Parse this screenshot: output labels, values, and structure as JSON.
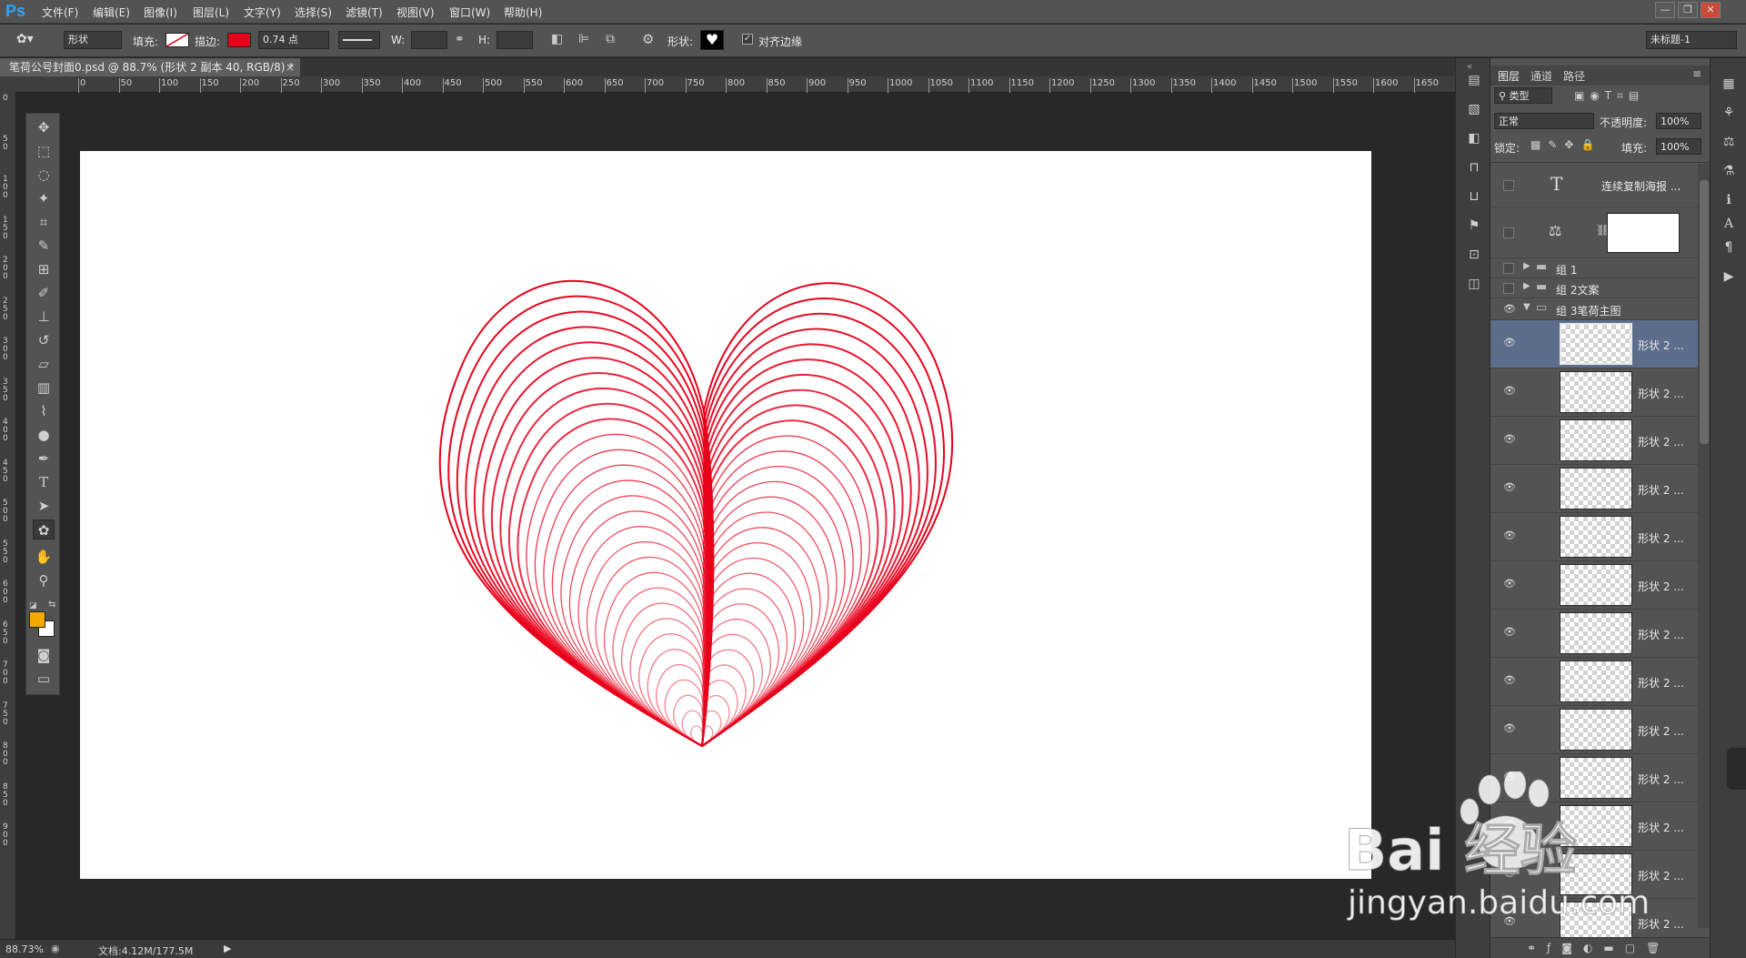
{
  "app": {
    "logo": "Ps"
  },
  "menu": [
    "文件(F)",
    "编辑(E)",
    "图像(I)",
    "图层(L)",
    "文字(Y)",
    "选择(S)",
    "滤镜(T)",
    "视图(V)",
    "窗口(W)",
    "帮助(H)"
  ],
  "window_buttons": [
    "—",
    "❐",
    "✕"
  ],
  "options": {
    "mode": "形状",
    "fill_label": "填充:",
    "stroke_label": "描边:",
    "stroke_color": "#e8001a",
    "stroke_width": "0.74 点",
    "w_label": "W:",
    "h_label": "H:",
    "shape_label": "形状:",
    "align_edges": "对齐边缘",
    "workspace": "未标题-1"
  },
  "document": {
    "tab_title": "笔荷公号封面0.psd @ 88.7% (形状 2 副本 40, RGB/8) *"
  },
  "ruler": {
    "h_ticks": [
      "0",
      "50",
      "100",
      "150",
      "200",
      "250",
      "300",
      "350",
      "400",
      "450",
      "500",
      "550",
      "600",
      "650",
      "700",
      "750",
      "800",
      "850",
      "900",
      "950",
      "1000",
      "1050",
      "1100",
      "1150",
      "1200",
      "1250",
      "1300",
      "1350",
      "1400",
      "1450",
      "1500",
      "1550",
      "1600",
      "1650"
    ],
    "v_ticks": [
      "0",
      "5 0",
      "1 0 0",
      "1 5 0",
      "2 0 0",
      "2 5 0",
      "3 0 0",
      "3 5 0",
      "4 0 0",
      "4 5 0",
      "5 0 0",
      "5 5 0",
      "6 0 0",
      "6 5 0",
      "7 0 0",
      "7 5 0",
      "8 0 0",
      "8 5 0",
      "9 0 0"
    ]
  },
  "tools": [
    "move-icon",
    "marquee-icon",
    "lasso-icon",
    "magic-wand-icon",
    "crop-icon",
    "eyedropper-icon",
    "healing-icon",
    "brush-icon",
    "stamp-icon",
    "history-brush-icon",
    "eraser-icon",
    "gradient-icon",
    "blur-icon",
    "dodge-icon",
    "pen-icon",
    "type-icon",
    "path-select-icon",
    "shape-icon",
    "hand-icon",
    "zoom-icon"
  ],
  "colors": {
    "foreground": "#f5a800",
    "background": "#ffffff",
    "heart_stroke": "#e8001a"
  },
  "status": {
    "zoom": "88.73%",
    "doc_size": "文档:4.12M/177.5M"
  },
  "layers_panel": {
    "tabs": [
      "图层",
      "通道",
      "路径"
    ],
    "filter_label": "类型",
    "blend_mode": "正常",
    "opacity_label": "不透明度:",
    "opacity_value": "100%",
    "lock_label": "锁定:",
    "fill_label": "填充:",
    "fill_value": "100%",
    "text_layer_name": "连续复制海报 ...",
    "groups": [
      "组 1",
      "组 2文案",
      "组 3笔荷主图"
    ],
    "shape_layer_name": "形状 2 ..."
  },
  "watermark": {
    "text": "Bai 经验",
    "url": "jingyan.baidu.com"
  }
}
